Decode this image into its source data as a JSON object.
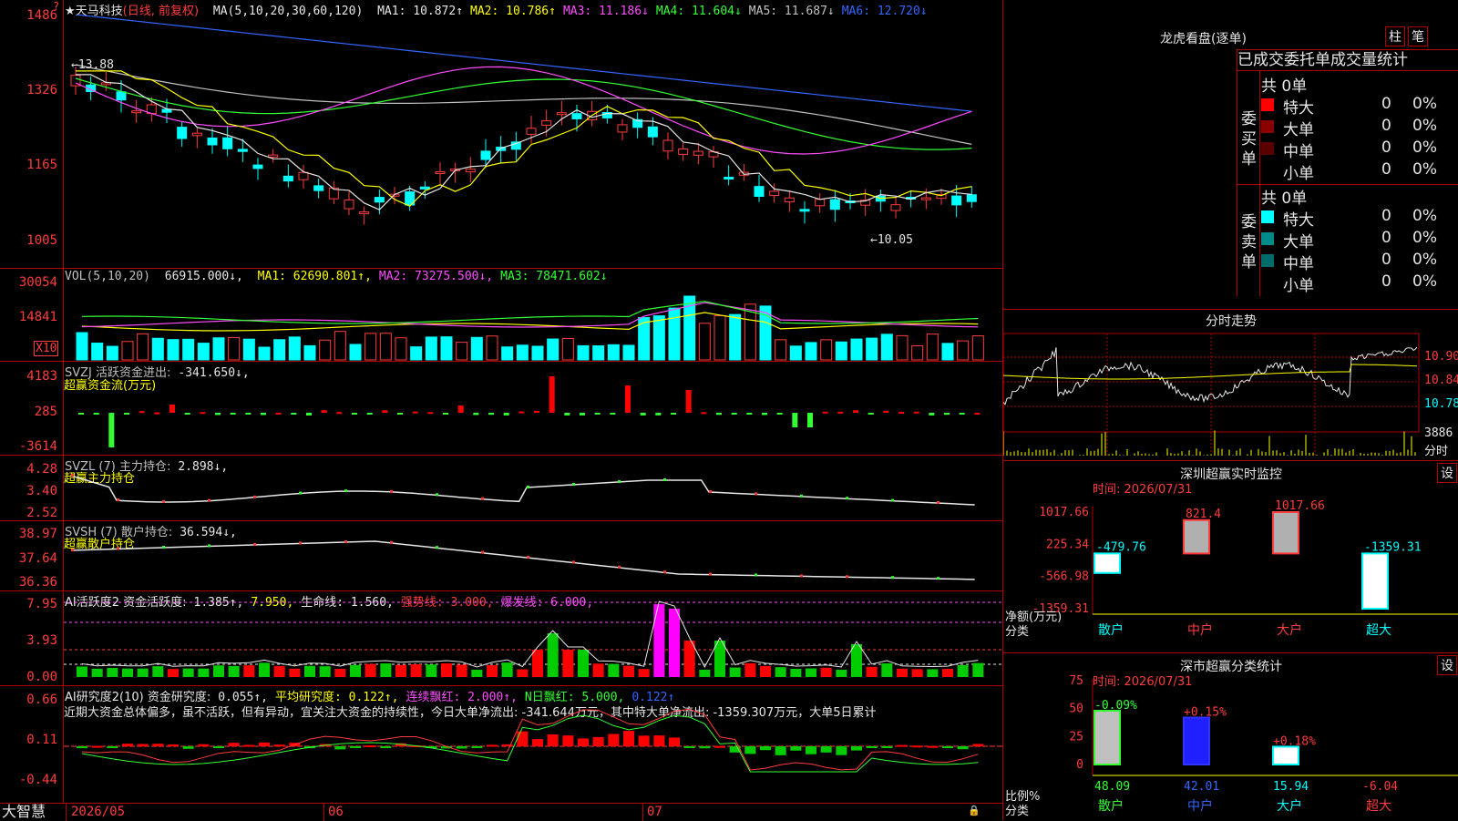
{
  "app": {
    "brand": "大智慧",
    "corner_mark": "?"
  },
  "kline": {
    "stock_name": "★天马科技",
    "mode": "(日线, 前复权)",
    "ma_params": "MA(5,10,20,30,60,120)",
    "ma_values": [
      {
        "label": "MA1:",
        "value": "10.872↑",
        "color": "#e6e6e6"
      },
      {
        "label": "MA2:",
        "value": "10.786↑",
        "color": "#ffff00"
      },
      {
        "label": "MA3:",
        "value": "11.186↓",
        "color": "#ff4cff"
      },
      {
        "label": "MA4:",
        "value": "11.604↓",
        "color": "#33ff33"
      },
      {
        "label": "MA5:",
        "value": "11.687↓",
        "color": "#c0c0c0"
      },
      {
        "label": "MA6:",
        "value": "12.720↓",
        "color": "#3366ff"
      }
    ],
    "axis": [
      "1486",
      "1326",
      "1165",
      "1005"
    ],
    "high_label": "13.88",
    "low_label": "←10.05"
  },
  "vol": {
    "title": "VOL(5,10,20)",
    "value": "66915.000↓,",
    "ma_values": [
      {
        "label": "MA1:",
        "value": "62690.801↑,",
        "color": "#ffff00"
      },
      {
        "label": "MA2:",
        "value": "73275.500↓,",
        "color": "#ff4cff"
      },
      {
        "label": "MA3:",
        "value": "78471.602↓",
        "color": "#33ff33"
      }
    ],
    "axis": [
      "30054",
      "14841"
    ],
    "multiplier": "X10"
  },
  "svzj": {
    "title": "SVZJ  活跃资金进出:",
    "value": "-341.650↓,",
    "subtitle": "超赢资金流(万元)",
    "axis": [
      "4183",
      "285",
      "-3614"
    ]
  },
  "svzl": {
    "title": "SVZL (7) 主力持仓:",
    "value": "2.898↓,",
    "subtitle": "超赢主力持仓",
    "axis": [
      "4.28",
      "3.40",
      "2.52"
    ]
  },
  "svsh": {
    "title": "SVSH (7) 散户持仓:",
    "value": "36.594↓,",
    "subtitle": "超赢散户持仓",
    "axis": [
      "38.97",
      "37.64",
      "36.36"
    ]
  },
  "ai1": {
    "title": "AI活跃度2 资金活跃度:",
    "items": [
      {
        "text": "1.385↑,",
        "color": "#e6e6e6"
      },
      {
        "text": "7.950,",
        "color": "#ffff00"
      },
      {
        "text": "生命线: 1.560,",
        "color": "#e6e6e6"
      },
      {
        "text": "强势线: 3.000,",
        "color": "#ff3c3c"
      },
      {
        "text": "爆发线: 6.000,",
        "color": "#ff4cff"
      }
    ],
    "axis": [
      "7.95",
      "3.93",
      "0.00"
    ]
  },
  "ai2": {
    "title": "AI研究度2(10) 资金研究度:",
    "items": [
      {
        "text": "0.055↑,",
        "color": "#e6e6e6"
      },
      {
        "text": "平均研究度: 0.122↑,",
        "color": "#ffff00"
      },
      {
        "text": "连续飘红: 2.000↑,",
        "color": "#ff4cff"
      },
      {
        "text": "N日飘红: 5.000,",
        "color": "#33ff33"
      },
      {
        "text": "0.122↑",
        "color": "#3366ff"
      }
    ],
    "commentary": "近期大资金总体偏多，虽不活跃，但有异动，宜关注大资金的持续性，今日大单净流出: -341.644万元，其中特大单净流出: -1359.307万元，大单5日累计",
    "axis": [
      "0.66",
      "0.11",
      "-0.44"
    ]
  },
  "dates": {
    "d1": "2026/05",
    "d2": "06",
    "d3": "07"
  },
  "dragon": {
    "title": "龙虎看盘(逐单)",
    "btn_zhu": "柱",
    "btn_bi": "笔",
    "header": "已成交委托单成交量统计",
    "buy_label": "委买单",
    "sell_label": "委卖单",
    "buy_total": "共 0单",
    "sell_total": "共 0单",
    "buy_rows": [
      {
        "name": "特大",
        "count": "0",
        "pct": "0%",
        "color": "#ff0000"
      },
      {
        "name": "大单",
        "count": "0",
        "pct": "0%",
        "color": "#8b0000"
      },
      {
        "name": "中单",
        "count": "0",
        "pct": "0%",
        "color": "#5a0000"
      },
      {
        "name": "小单",
        "count": "0",
        "pct": "0%",
        "color": ""
      }
    ],
    "sell_rows": [
      {
        "name": "特大",
        "count": "0",
        "pct": "0%",
        "color": "#00ffff"
      },
      {
        "name": "大单",
        "count": "0",
        "pct": "0%",
        "color": "#008b8b"
      },
      {
        "name": "中单",
        "count": "0",
        "pct": "0%",
        "color": "#006b6b"
      },
      {
        "name": "小单",
        "count": "0",
        "pct": "0%",
        "color": ""
      }
    ]
  },
  "intraday": {
    "title": "分时走势",
    "p1": "10.90",
    "p2": "10.84",
    "p3": "10.78",
    "vol": "3886",
    "vol_unit": "分时"
  },
  "monitor": {
    "title": "深圳超赢实时监控",
    "btn": "设",
    "time_label": "时间: 2026/07/31",
    "ylabel": "净额(万元)",
    "xlabel": "分类",
    "categories": [
      "散户",
      "中户",
      "大户",
      "超大"
    ],
    "values": [
      -479.76,
      821.4,
      1017.66,
      -1359.31
    ],
    "value_labels": [
      "-479.76",
      "821.4",
      "1017.66",
      "-1359.31"
    ],
    "axis": [
      "1017.66",
      "225.34",
      "-566.98",
      "-1359.31"
    ]
  },
  "stats": {
    "title": "深市超赢分类统计",
    "btn": "设",
    "time_label": "时间: 2026/07/31",
    "ylabel": "比例%",
    "xlabel": "分类",
    "categories": [
      "散户",
      "中户",
      "大户",
      "超大"
    ],
    "values": [
      48.09,
      42.01,
      15.94,
      -6.04
    ],
    "changes": [
      "-0.09%",
      "+0.15%",
      "+0.18%",
      ""
    ],
    "axis": [
      "75",
      "50",
      "25",
      "0"
    ]
  }
}
